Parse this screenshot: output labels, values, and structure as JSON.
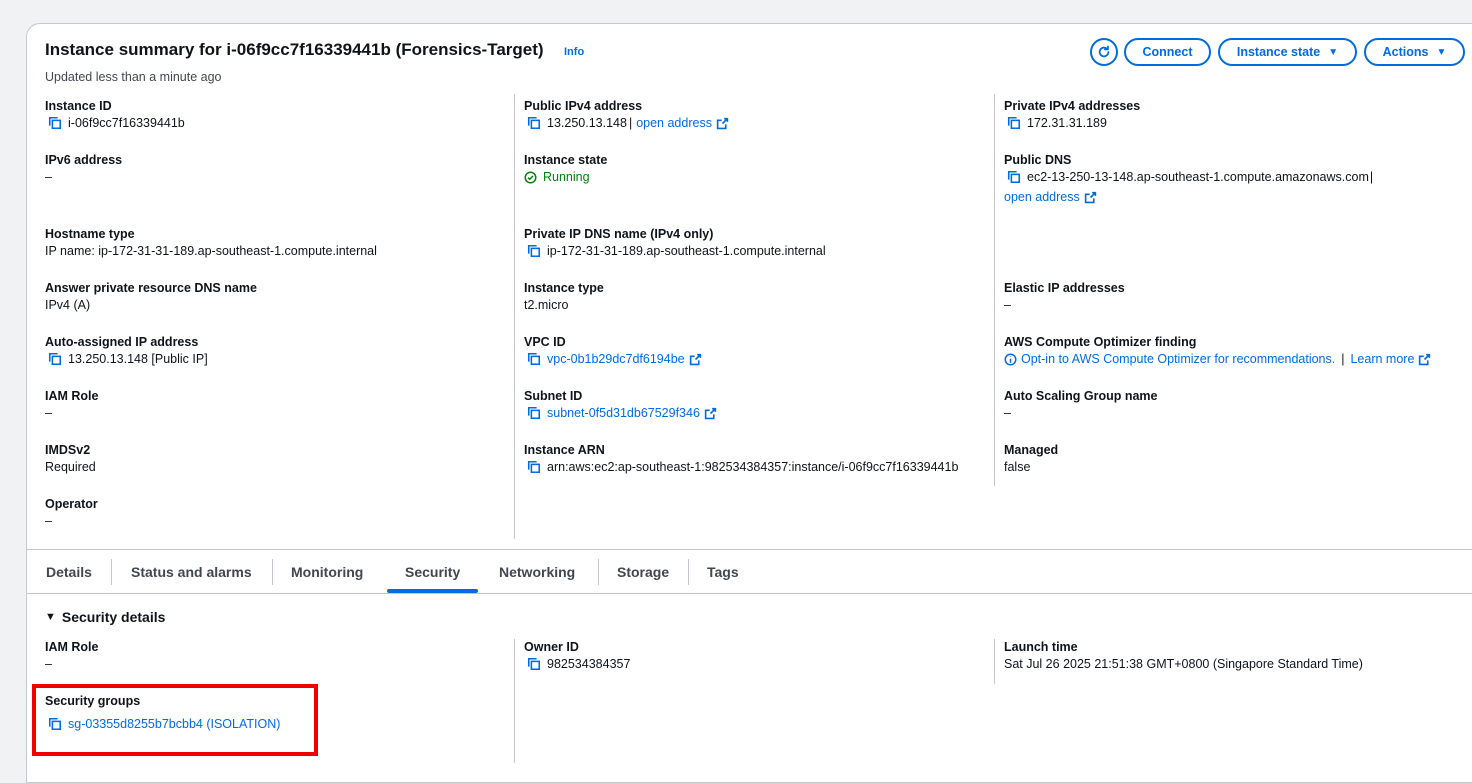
{
  "header": {
    "title": "Instance summary for i-06f9cc7f16339441b (Forensics-Target)",
    "info": "Info",
    "updated": "Updated less than a minute ago",
    "connect": "Connect",
    "instance_state_btn": "Instance state",
    "actions_btn": "Actions"
  },
  "col1": {
    "instance_id_label": "Instance ID",
    "instance_id": "i-06f9cc7f16339441b",
    "ipv6_label": "IPv6 address",
    "ipv6": "–",
    "hostname_type_label": "Hostname type",
    "hostname_type": "IP name: ip-172-31-31-189.ap-southeast-1.compute.internal",
    "answer_dns_label": "Answer private resource DNS name",
    "answer_dns": "IPv4 (A)",
    "auto_ip_label": "Auto-assigned IP address",
    "auto_ip": "13.250.13.148 [Public IP]",
    "iam_role_label": "IAM Role",
    "iam_role": "–",
    "imdsv2_label": "IMDSv2",
    "imdsv2": "Required",
    "operator_label": "Operator",
    "operator": "–"
  },
  "col2": {
    "public_ipv4_label": "Public IPv4 address",
    "public_ipv4": "13.250.13.148",
    "separator": "|",
    "open_address": "open address",
    "instance_state_label": "Instance state",
    "instance_state": "Running",
    "private_dns_label": "Private IP DNS name (IPv4 only)",
    "private_dns": "ip-172-31-31-189.ap-southeast-1.compute.internal",
    "instance_type_label": "Instance type",
    "instance_type": "t2.micro",
    "vpc_label": "VPC ID",
    "vpc": "vpc-0b1b29dc7df6194be",
    "subnet_label": "Subnet ID",
    "subnet": "subnet-0f5d31db67529f346",
    "arn_label": "Instance ARN",
    "arn": "arn:aws:ec2:ap-southeast-1:982534384357:instance/i-06f9cc7f16339441b"
  },
  "col3": {
    "private_ipv4_label": "Private IPv4 addresses",
    "private_ipv4": "172.31.31.189",
    "public_dns_label": "Public DNS",
    "public_dns": "ec2-13-250-13-148.ap-southeast-1.compute.amazonaws.com",
    "public_dns_sep": "|",
    "open_address": "open address",
    "elastic_ip_label": "Elastic IP addresses",
    "elastic_ip": "–",
    "optimizer_label": "AWS Compute Optimizer finding",
    "optimizer": "Opt-in to AWS Compute Optimizer for recommendations.",
    "optimizer_sep": "|",
    "learn_more": "Learn more",
    "asg_label": "Auto Scaling Group name",
    "asg": "–",
    "managed_label": "Managed",
    "managed": "false"
  },
  "tabs": [
    "Details",
    "Status and alarms",
    "Monitoring",
    "Security",
    "Networking",
    "Storage",
    "Tags"
  ],
  "security": {
    "section_title": "Security details",
    "iam_role_label": "IAM Role",
    "iam_role": "–",
    "owner_label": "Owner ID",
    "owner": "982534384357",
    "launch_label": "Launch time",
    "launch": "Sat Jul 26 2025 21:51:38 GMT+0800 (Singapore Standard Time)",
    "sg_label": "Security groups",
    "sg": "sg-03355d8255b7bcbb4 (ISOLATION)"
  },
  "colors": {
    "link": "#006ce0",
    "success": "#037f0c",
    "highlight": "#f00000"
  }
}
